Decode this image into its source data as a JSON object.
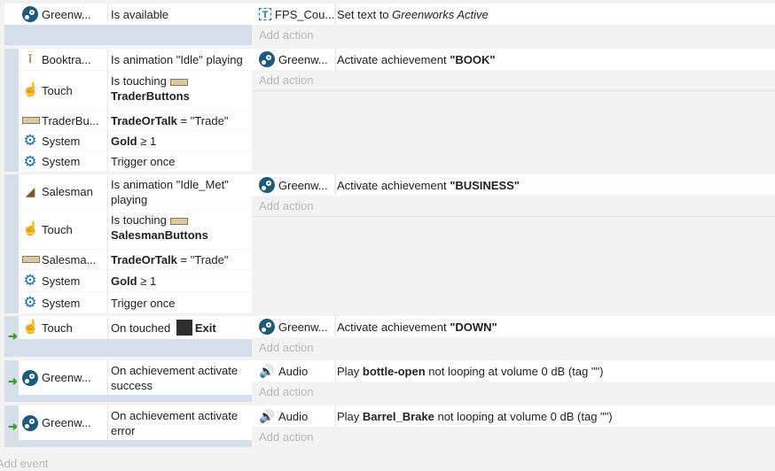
{
  "add_action": "Add action",
  "add_event": "Add event",
  "events": [
    {
      "conditions": [
        {
          "object": "Greenw...",
          "icon": "steam-icon",
          "text": "Is available"
        }
      ],
      "actions": [
        {
          "object": "FPS_Cou...",
          "icon": "text-icon",
          "text_prefix": "Set text to ",
          "text_value": "Greenworks Active"
        }
      ]
    },
    {
      "conditions": [
        {
          "object": "Booktra...",
          "icon": "character-icon",
          "text": "Is animation \"Idle\" playing"
        },
        {
          "object": "Touch",
          "icon": "touch-icon",
          "text_prefix": "Is touching",
          "text_bold": "TraderButtons"
        },
        {
          "object": "TraderBu...",
          "icon": "plank-icon",
          "text_bold": "TradeOrTalk",
          "text_suffix": " = \"Trade\""
        },
        {
          "object": "System",
          "icon": "gear-icon",
          "text_bold": "Gold",
          "text_suffix": " ≥ 1"
        },
        {
          "object": "System",
          "icon": "gear-icon",
          "text": "Trigger once"
        }
      ],
      "actions": [
        {
          "object": "Greenw...",
          "icon": "steam-icon",
          "text_prefix": "Activate achievement ",
          "text_bold": "\"BOOK\""
        }
      ]
    },
    {
      "conditions": [
        {
          "object": "Salesman",
          "icon": "character-icon",
          "text": "Is animation \"Idle_Met\" playing"
        },
        {
          "object": "Touch",
          "icon": "touch-icon",
          "text_prefix": "Is touching",
          "text_bold": "SalesmanButtons"
        },
        {
          "object": "Salesma...",
          "icon": "plank-icon",
          "text_bold": "TradeOrTalk",
          "text_suffix": " = \"Trade\""
        },
        {
          "object": "System",
          "icon": "gear-icon",
          "text_bold": "Gold",
          "text_suffix": " ≥ 1"
        },
        {
          "object": "System",
          "icon": "gear-icon",
          "text": "Trigger once"
        }
      ],
      "actions": [
        {
          "object": "Greenw...",
          "icon": "steam-icon",
          "text_prefix": "Activate achievement ",
          "text_bold": "\"BUSINESS\""
        }
      ]
    },
    {
      "conditions": [
        {
          "object": "Touch",
          "icon": "touch-icon",
          "text_prefix": "On touched ",
          "text_bold": "Exit"
        }
      ],
      "actions": [
        {
          "object": "Greenw...",
          "icon": "steam-icon",
          "text_prefix": "Activate achievement ",
          "text_bold": "\"DOWN\""
        }
      ]
    },
    {
      "conditions": [
        {
          "object": "Greenw...",
          "icon": "steam-icon",
          "text": "On achievement activate success"
        }
      ],
      "actions": [
        {
          "object": "Audio",
          "icon": "speaker-icon",
          "text_prefix": "Play ",
          "text_bold": "bottle-open",
          "text_suffix": " not looping at volume 0 dB (tag \"\")"
        }
      ]
    },
    {
      "conditions": [
        {
          "object": "Greenw...",
          "icon": "steam-icon",
          "text": "On achievement activate error"
        }
      ],
      "actions": [
        {
          "object": "Audio",
          "icon": "speaker-icon",
          "text_prefix": "Play ",
          "text_bold": "Barrel_Brake",
          "text_suffix": " not looping at volume 0 dB (tag \"\")"
        }
      ]
    }
  ],
  "colors": {
    "band": "#d6dfe9",
    "trigger_arrow": "#3f9a2f",
    "icon_blue": "#1f6fb2",
    "add_text": "#b8b8b8"
  }
}
